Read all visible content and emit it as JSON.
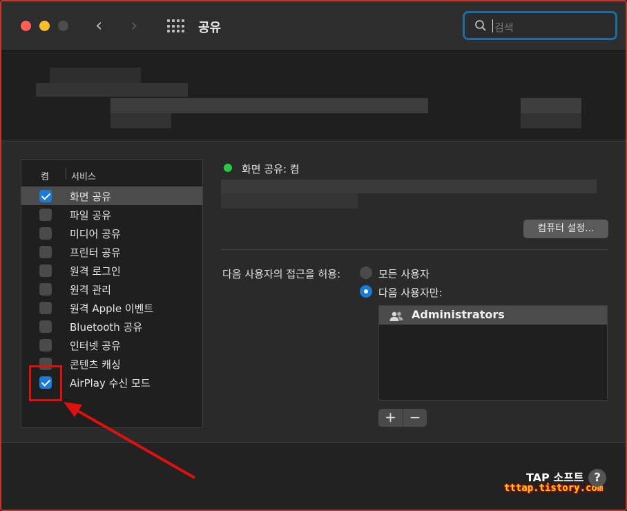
{
  "window": {
    "title": "공유",
    "search_placeholder": "검색"
  },
  "services": {
    "header_on": "켬",
    "header_service": "서비스",
    "items": [
      {
        "label": "화면 공유",
        "checked": true,
        "selected": true
      },
      {
        "label": "파일 공유",
        "checked": false
      },
      {
        "label": "미디어 공유",
        "checked": false
      },
      {
        "label": "프린터 공유",
        "checked": false
      },
      {
        "label": "원격 로그인",
        "checked": false
      },
      {
        "label": "원격 관리",
        "checked": false
      },
      {
        "label": "원격 Apple 이벤트",
        "checked": false
      },
      {
        "label": "Bluetooth 공유",
        "checked": false
      },
      {
        "label": "인터넷 공유",
        "checked": false
      },
      {
        "label": "콘텐츠 캐싱",
        "checked": false
      },
      {
        "label": "AirPlay 수신 모드",
        "checked": true
      }
    ]
  },
  "detail": {
    "status": "화면 공유: 켬",
    "computer_settings_button": "컴퓨터 설정...",
    "allow_access_label": "다음 사용자의 접근을 허용:",
    "radio_all_users": "모든 사용자",
    "radio_only_users": "다음 사용자만:",
    "selected_radio": "only",
    "users": [
      "Administrators"
    ],
    "add_button": "+",
    "remove_button": "−"
  },
  "help_button": "?",
  "watermark": {
    "line1": "TAP 소프트",
    "line2": "tttap.tistory.com"
  },
  "colors": {
    "accent": "#1a7bd9",
    "status_on": "#28c840",
    "annotation": "#e0100f"
  }
}
